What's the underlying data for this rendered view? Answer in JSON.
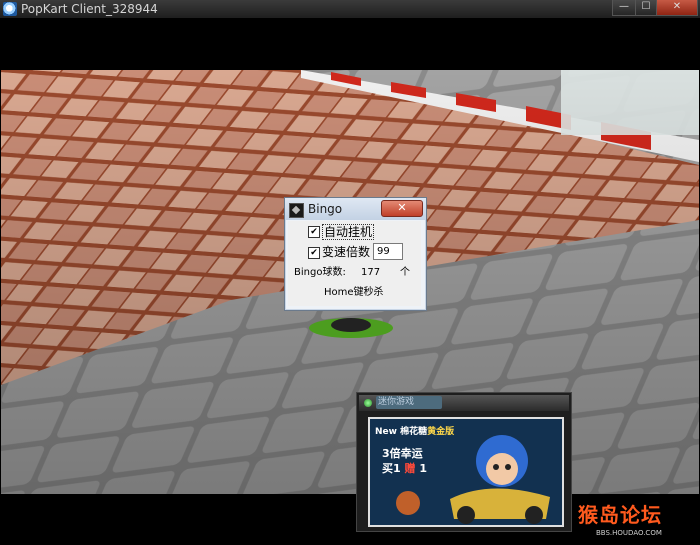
{
  "window": {
    "title": "PopKart Client_328944",
    "min_glyph": "—",
    "max_glyph": "☐",
    "close_glyph": "✕",
    "icon": "app-icon"
  },
  "bingo": {
    "title": "Bingo",
    "close_glyph": "✕",
    "auto_hang_label": "自动挂机",
    "auto_hang_checked": true,
    "speed_multiplier_label": "变速倍数",
    "speed_multiplier_checked": true,
    "speed_multiplier_value": "99",
    "ball_count_label": "Bingo球数:",
    "ball_count_value": "177",
    "ball_count_unit": "个",
    "hotkey_text": "Home键秒杀"
  },
  "ad": {
    "header_title": "迷你游戏",
    "line1_prefix": "New 棉花糖",
    "line1_gold": "黄金版",
    "line2": "3倍幸运",
    "line3_a": "买1",
    "line3_red": "赠",
    "line3_b": "1"
  },
  "watermark": {
    "logo_text": "猴岛论坛",
    "url_text": "BBS.HOUDAO.COM"
  },
  "colors": {
    "close_red": "#c0402a",
    "bingo_title_bg": "#c3d2e4",
    "watermark_orange": "#ff5a1e"
  }
}
